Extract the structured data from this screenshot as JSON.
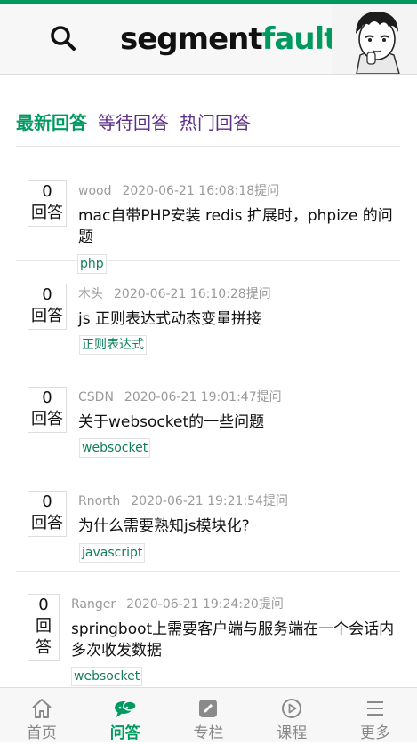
{
  "header": {
    "logo_part1": "segment",
    "logo_part2": "fault"
  },
  "tabs": [
    {
      "label": "最新回答"
    },
    {
      "label": "等待回答"
    },
    {
      "label": "热门回答"
    }
  ],
  "questions": [
    {
      "count": "0",
      "count_label": "回答",
      "user": "wood",
      "time": "2020-06-21 16:08:18提问",
      "title": "mac自带PHP安装 redis 扩展时，phpize 的问题",
      "tag": "php"
    },
    {
      "count": "0",
      "count_label": "回答",
      "user": "木头",
      "time": "2020-06-21 16:10:28提问",
      "title": "js 正则表达式动态变量拼接",
      "tag": "正则表达式"
    },
    {
      "count": "0",
      "count_label": "回答",
      "user": "CSDN",
      "time": "2020-06-21 19:01:47提问",
      "title": "关于websocket的一些问题",
      "tag": "websocket"
    },
    {
      "count": "0",
      "count_label": "回答",
      "user": "Rnorth",
      "time": "2020-06-21 19:21:54提问",
      "title": "为什么需要熟知js模块化?",
      "tag": "javascript"
    },
    {
      "count": "0",
      "count_label": "回答",
      "user": "Ranger",
      "time": "2020-06-21 19:24:20提问",
      "title": "springboot上需要客户端与服务端在一个会话内多次收发数据",
      "tag": "websocket"
    }
  ],
  "nav": [
    {
      "label": "首页",
      "icon": "home-icon"
    },
    {
      "label": "问答",
      "icon": "chat-icon"
    },
    {
      "label": "专栏",
      "icon": "edit-icon"
    },
    {
      "label": "课程",
      "icon": "play-icon"
    },
    {
      "label": "更多",
      "icon": "menu-icon"
    }
  ],
  "colors": {
    "brand": "#009a61",
    "tab_inactive": "#5b2f86",
    "tag_text": "#118059"
  }
}
